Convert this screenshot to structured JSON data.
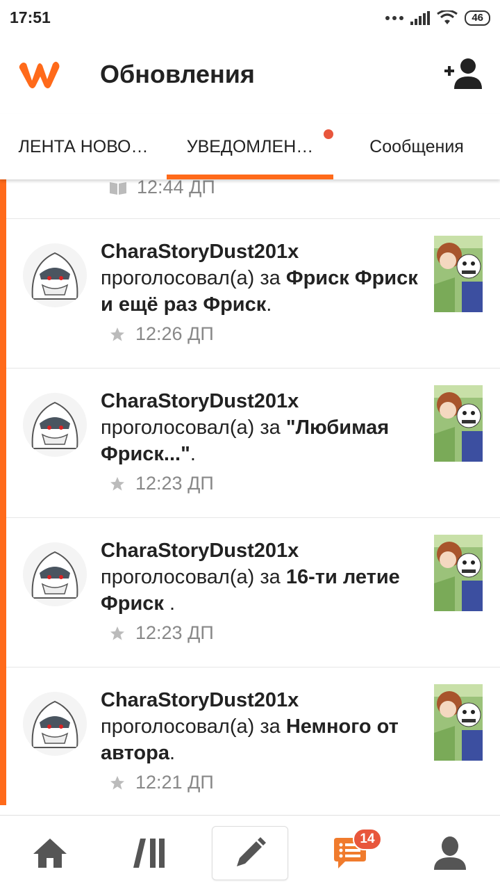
{
  "status_bar": {
    "time": "17:51",
    "battery": "46",
    "icons": [
      "more-dots-icon",
      "signal-icon",
      "wifi-icon",
      "battery-icon"
    ]
  },
  "header": {
    "title": "Обновления",
    "logo_icon": "wattpad-logo",
    "action_icon": "add-user-icon"
  },
  "tabs": [
    {
      "label": "ЛЕНТА НОВО…",
      "active": false
    },
    {
      "label": "УВЕДОМЛЕН…",
      "active": true,
      "has_dot": true
    },
    {
      "label": "Сообщения",
      "active": false
    }
  ],
  "feed": {
    "partial_item": {
      "time": "12:44 ДП",
      "icon": "book-icon"
    },
    "items": [
      {
        "user": "CharaStoryDust201x",
        "action": "проголосовал(а) за ",
        "story": "Фриск Фриск и ещё раз Фриск",
        "suffix": ".",
        "time": "12:26 ДП",
        "icon": "star-icon"
      },
      {
        "user": "CharaStoryDust201x",
        "action": "проголосовал(а) за ",
        "story": "\"Любимая Фриск...\"",
        "suffix": ".",
        "time": "12:23 ДП",
        "icon": "star-icon"
      },
      {
        "user": "CharaStoryDust201x",
        "action": "проголосовал(а) за ",
        "story": "16-ти летие Фриск ",
        "suffix": ".",
        "time": "12:23 ДП",
        "icon": "star-icon"
      },
      {
        "user": "CharaStoryDust201x",
        "action": "проголосовал(а) за ",
        "story": "Немного от автора",
        "suffix": ".",
        "time": "12:21 ДП",
        "icon": "star-icon"
      }
    ]
  },
  "bottom_nav": {
    "items": [
      "home-icon",
      "library-icon",
      "write-icon",
      "notifications-icon",
      "profile-icon"
    ],
    "badge": "14"
  },
  "colors": {
    "accent": "#ff6a1a",
    "badge": "#e8563c"
  }
}
